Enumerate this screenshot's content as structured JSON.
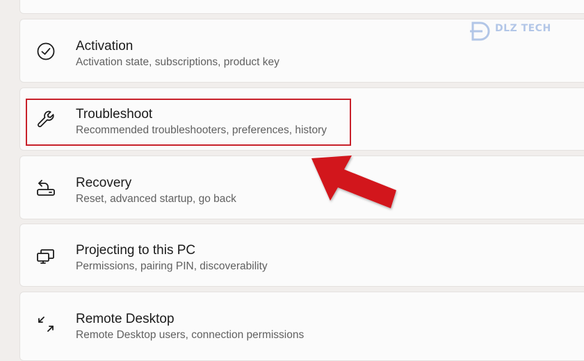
{
  "settings_items": [
    {
      "title": "Activation",
      "subtitle": "Activation state, subscriptions, product key",
      "icon": "check-circle-icon"
    },
    {
      "title": "Troubleshoot",
      "subtitle": "Recommended troubleshooters, preferences, history",
      "icon": "wrench-icon"
    },
    {
      "title": "Recovery",
      "subtitle": "Reset, advanced startup, go back",
      "icon": "recovery-drive-icon"
    },
    {
      "title": "Projecting to this PC",
      "subtitle": "Permissions, pairing PIN, discoverability",
      "icon": "project-to-pc-icon"
    },
    {
      "title": "Remote Desktop",
      "subtitle": "Remote Desktop users, connection permissions",
      "icon": "remote-desktop-icon"
    }
  ],
  "watermark": {
    "text": "DLZ TECH"
  },
  "colors": {
    "highlight": "#c8202a",
    "arrow": "#d2141c",
    "card_background": "#fbfbfb",
    "page_background": "#f1eeec"
  }
}
